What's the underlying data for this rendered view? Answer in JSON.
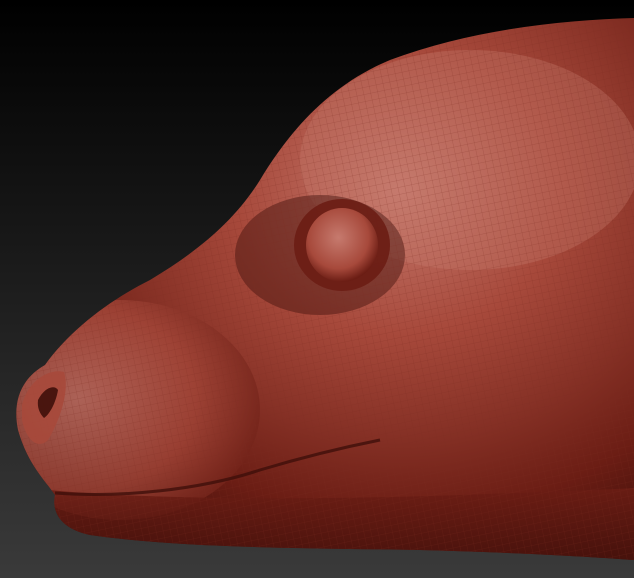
{
  "scene": {
    "subject": "sculpted-animal-head-wireframe",
    "colors": {
      "background_top": "#000000",
      "background_bottom": "#3a3a3a",
      "clay_highlight": "#c67a6e",
      "clay_mid": "#a7493b",
      "clay_shadow": "#6b1d14",
      "clay_deep": "#3f0f0a",
      "wire": "#7a2a20"
    },
    "icons": [
      "eye-shape",
      "nostril-shape",
      "mouth-line"
    ]
  }
}
